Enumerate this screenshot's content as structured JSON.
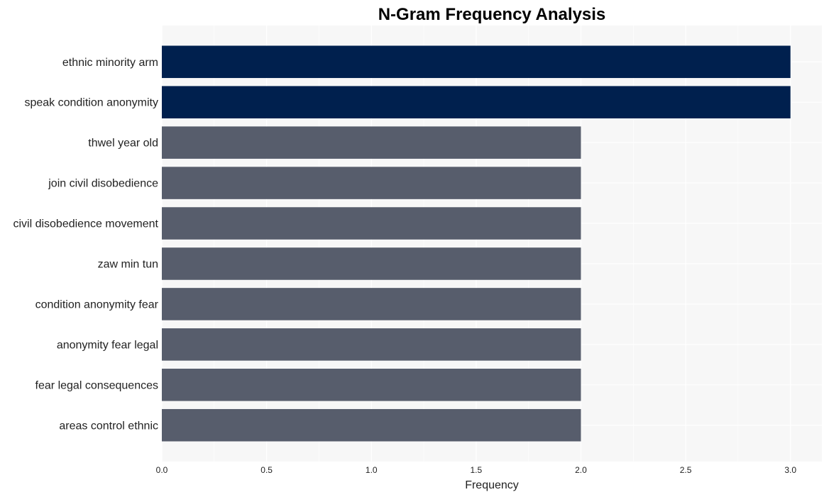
{
  "chart_data": {
    "type": "bar",
    "orientation": "horizontal",
    "title": "N-Gram Frequency Analysis",
    "xlabel": "Frequency",
    "ylabel": "",
    "categories": [
      "ethnic minority arm",
      "speak condition anonymity",
      "thwel year old",
      "join civil disobedience",
      "civil disobedience movement",
      "zaw min tun",
      "condition anonymity fear",
      "anonymity fear legal",
      "fear legal consequences",
      "areas control ethnic"
    ],
    "values": [
      3,
      3,
      2,
      2,
      2,
      2,
      2,
      2,
      2,
      2
    ],
    "xlim": [
      0,
      3.15
    ],
    "xticks": [
      0.0,
      0.5,
      1.0,
      1.5,
      2.0,
      2.5,
      3.0
    ],
    "xtick_labels": [
      "0.0",
      "0.5",
      "1.0",
      "1.5",
      "2.0",
      "2.5",
      "3.0"
    ],
    "grid": true,
    "legend": "none",
    "colors": {
      "highlight": "#00204e",
      "default": "#575d6c",
      "panel_background": "#f7f7f7",
      "grid": "#ffffff"
    }
  }
}
